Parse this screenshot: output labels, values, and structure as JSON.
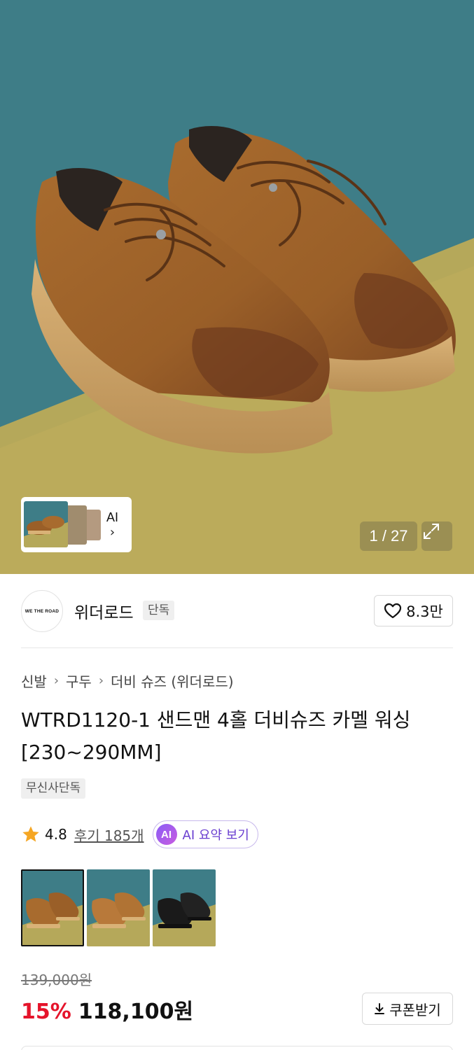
{
  "gallery": {
    "counter": "1 / 27",
    "preview_ai_label": "AI",
    "preview_chevron": "›",
    "expand_icon": "expand-icon"
  },
  "brand": {
    "logo_text": "WE THE ROAD",
    "name": "위더로드",
    "tag": "단독",
    "likes": "8.3만",
    "like_icon": "heart-outline-icon"
  },
  "breadcrumb": [
    "신발",
    "구두",
    "더비 슈즈 (위더로드)"
  ],
  "breadcrumb_separator": "›",
  "product": {
    "title": "WTRD1120-1 샌드맨 4홀 더비슈즈 카멜 워싱 [230~290MM]",
    "badge": "무신사단독",
    "rating": "4.8",
    "reviews": "후기 185개",
    "ai_summary_icon_text": "AI",
    "ai_summary_label": "AI 요약 보기",
    "original_price": "139,000원",
    "discount": "15%",
    "sale_price": "118,100원",
    "coupon_label": "쿠폰받기"
  },
  "color_options": [
    {
      "name": "camel-washing",
      "selected": true
    },
    {
      "name": "camel",
      "selected": false
    },
    {
      "name": "black",
      "selected": false
    }
  ],
  "colors": {
    "discount_red": "#e5142b",
    "ai_purple": "#6a3fd0",
    "star_orange": "#f5a623"
  }
}
